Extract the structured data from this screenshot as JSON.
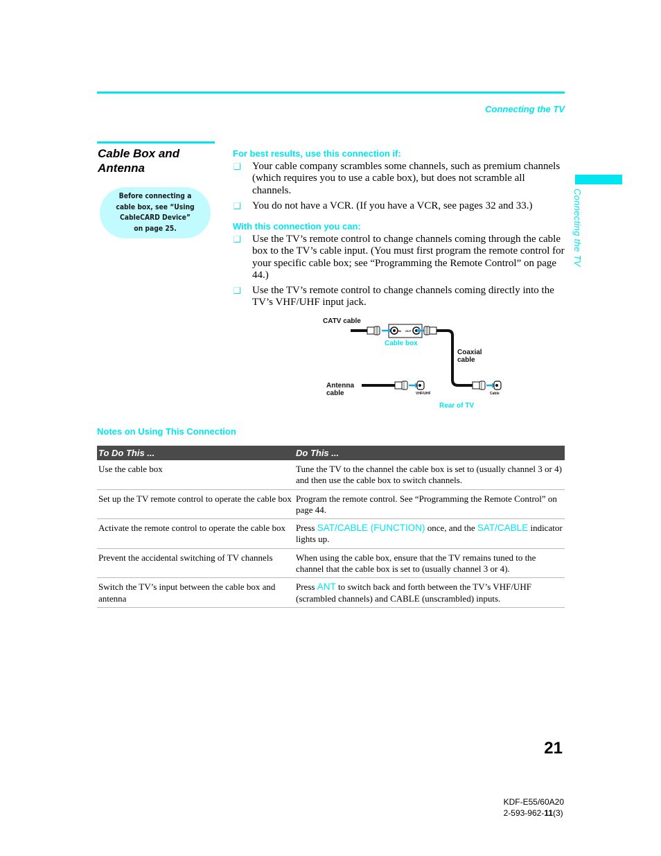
{
  "running_head": "Connecting the TV",
  "side_tab": {
    "label": "Connecting the TV"
  },
  "section": {
    "title_line1": "Cable Box and",
    "title_line2": "Antenna"
  },
  "note_bubble": {
    "text": "Before connecting a cable box, see “Using CableCARD Device” on page 25."
  },
  "best_results": {
    "heading": "For best results, use this connection if:",
    "items": [
      "Your cable company scrambles some channels, such as premium channels (which requires you to use a cable box), but does not scramble all channels.",
      "You do not have a VCR. (If you have a VCR, see pages 32 and 33.)"
    ]
  },
  "with_connection": {
    "heading": "With this connection you can:",
    "items": [
      "Use the TV’s remote control to change channels coming through the cable box to the TV’s cable input. (You must first program the remote control for your specific cable box; see “Programming the Remote Control” on page 44.)",
      "Use the TV’s remote control to change channels coming directly into the TV’s VHF/UHF input jack."
    ]
  },
  "diagram": {
    "catv_label": "CATV cable",
    "cable_box_label": "Cable box",
    "in_label": "IN",
    "out_label": "OUT",
    "coaxial_line1": "Coaxial",
    "coaxial_line2": "cable",
    "antenna_line1": "Antenna",
    "antenna_line2": "cable",
    "vhf_uhf_label": "VHF/UHF",
    "cable_jack_label": "Cable",
    "rear_of_tv_label": "Rear of TV"
  },
  "notes": {
    "title": "Notes on Using This Connection",
    "headers": [
      "To Do This ...",
      "Do This ..."
    ],
    "rows": [
      {
        "todo": "Use the cable box",
        "do_pre": "Tune the TV to the channel the cable box is set to (usually channel 3 or 4) and then use the cable box to switch channels.",
        "hl1": "",
        "do_mid": "",
        "hl2": "",
        "do_post": ""
      },
      {
        "todo": "Set up the TV remote control to operate the cable box",
        "do_pre": "Program the remote control. See “Programming the Remote Control” on page 44.",
        "hl1": "",
        "do_mid": "",
        "hl2": "",
        "do_post": ""
      },
      {
        "todo": "Activate the remote control to operate the cable box",
        "do_pre": "Press ",
        "hl1": "SAT/CABLE (FUNCTION)",
        "do_mid": " once, and the ",
        "hl2": "SAT/CABLE",
        "do_post": " indicator lights up."
      },
      {
        "todo": "Prevent the accidental switching of TV channels",
        "do_pre": "When using the cable box, ensure that the TV remains tuned to the channel that the cable box is set to (usually channel 3 or 4).",
        "hl1": "",
        "do_mid": "",
        "hl2": "",
        "do_post": ""
      },
      {
        "todo": "Switch the TV’s input between the cable box and antenna",
        "do_pre": "Press ",
        "hl1": "ANT",
        "do_mid": " to switch back and forth between the TV’s VHF/UHF (scrambled channels) and CABLE (unscrambled) inputs.",
        "hl2": "",
        "do_post": ""
      }
    ]
  },
  "footer": {
    "page_number": "21",
    "model": "KDF-E55/60A20",
    "part_number_pre": "2-593-962-",
    "part_number_bold": "11",
    "part_number_post": "(3)"
  },
  "colors": {
    "accent": "#00e5f0",
    "bubble_fill": "#c2fbff",
    "table_header": "#4a4a4a"
  }
}
